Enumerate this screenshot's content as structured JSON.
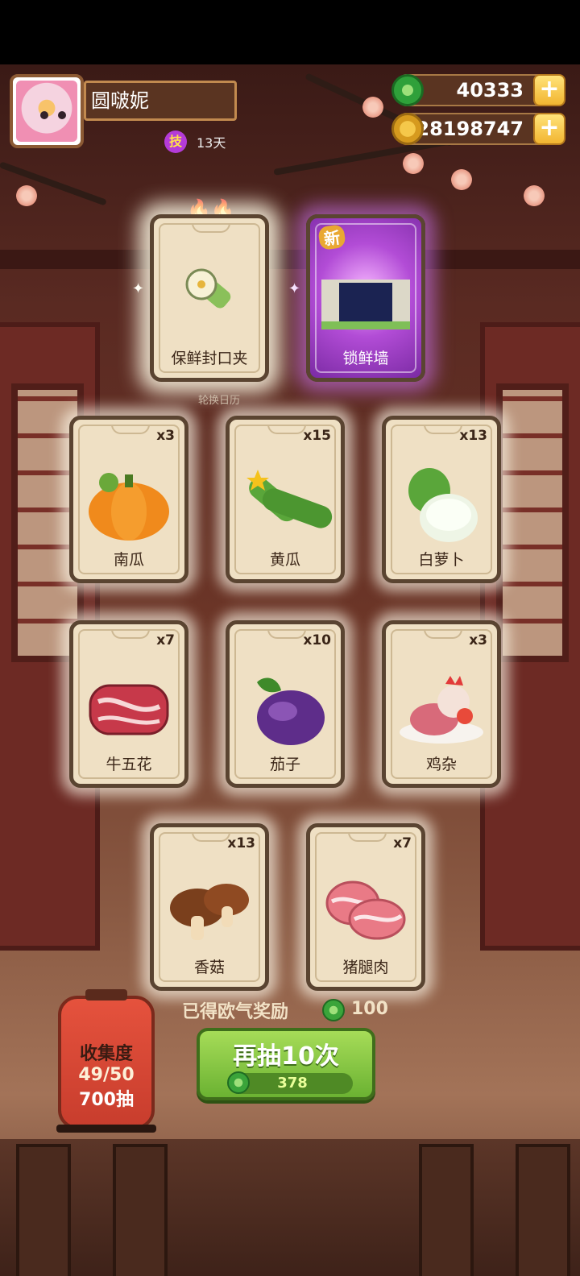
{
  "player": {
    "name": "圆啵妮",
    "skill_badge": "技",
    "days": "13天"
  },
  "currencies": {
    "jade": "40333",
    "coins": "28198747",
    "plus_label": "+"
  },
  "featured": [
    {
      "label": "保鲜封口夹",
      "icon": "clip-icon"
    },
    {
      "label": "锁鲜墙",
      "icon": "wall-icon",
      "badge": "新"
    }
  ],
  "caption": "轮换日历",
  "rewards": [
    {
      "label": "南瓜",
      "qty": "x3",
      "icon": "pumpkin-icon"
    },
    {
      "label": "黄瓜",
      "qty": "x15",
      "icon": "cucumber-icon"
    },
    {
      "label": "白萝卜",
      "qty": "x13",
      "icon": "radish-icon"
    },
    {
      "label": "牛五花",
      "qty": "x7",
      "icon": "beef-icon"
    },
    {
      "label": "茄子",
      "qty": "x10",
      "icon": "eggplant-icon"
    },
    {
      "label": "鸡杂",
      "qty": "x3",
      "icon": "chicken-icon"
    },
    {
      "label": "香菇",
      "qty": "x13",
      "icon": "mushroom-icon"
    },
    {
      "label": "猪腿肉",
      "qty": "x7",
      "icon": "pork-icon"
    }
  ],
  "collection": {
    "title": "收集度",
    "progress": "49/50",
    "draws": "700抽"
  },
  "luck_reward": {
    "label": "已得欧气奖励",
    "value": "100"
  },
  "draw_button": {
    "label": "再抽10次",
    "cost": "378"
  },
  "colors": {
    "accent_green": "#6bb232",
    "card_bg": "#efe0c4",
    "new_purple": "#b24cd6"
  }
}
